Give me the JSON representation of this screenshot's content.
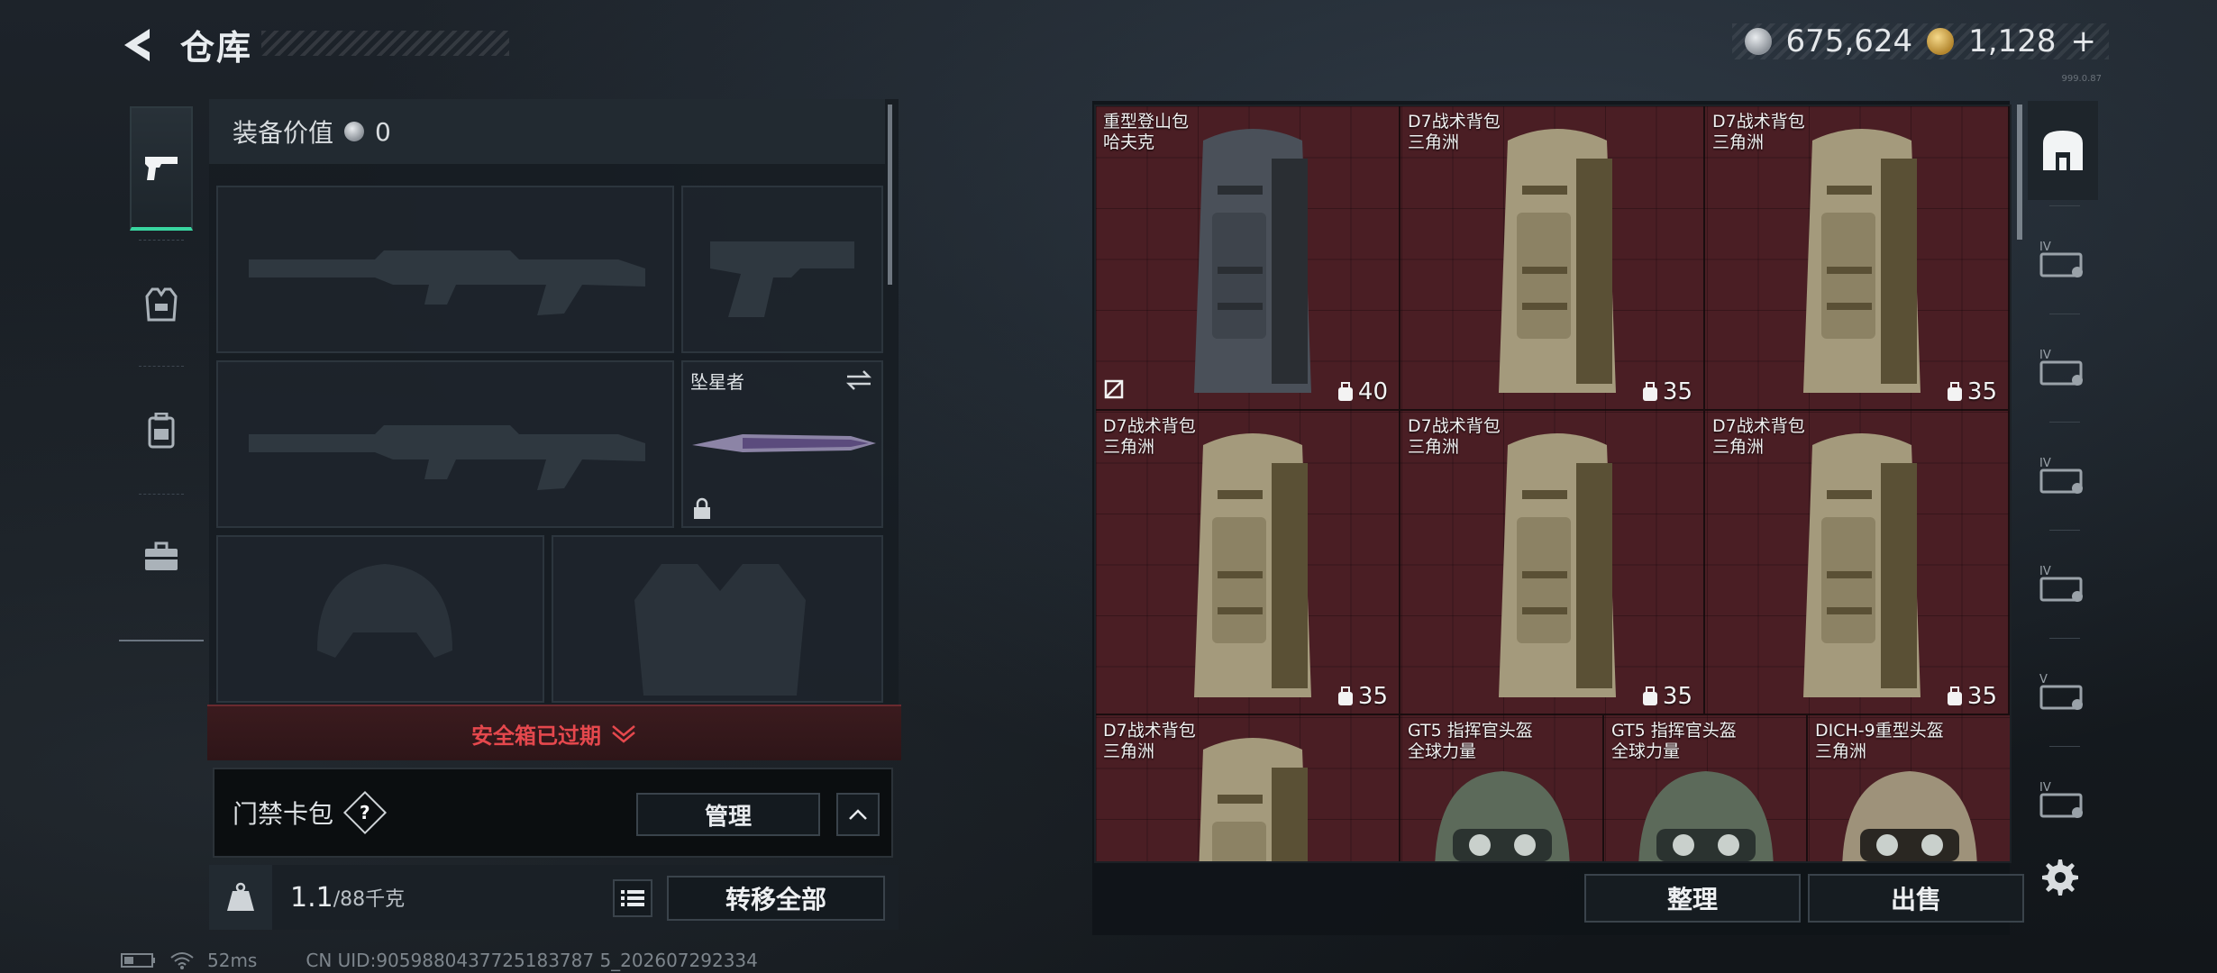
{
  "header": {
    "title": "仓库",
    "currency": [
      {
        "name": "silver-coin",
        "value": "675,624",
        "color": "#c9ced3"
      },
      {
        "name": "gold-coin",
        "value": "1,128",
        "suffix": "+",
        "color": "#d9b25a"
      }
    ],
    "version": "999.0.87"
  },
  "rail": {
    "items": [
      {
        "icon": "pistol-icon",
        "active": true
      },
      {
        "icon": "vest-icon",
        "active": false
      },
      {
        "icon": "backpack-icon",
        "active": false
      },
      {
        "icon": "toolbox-icon",
        "active": false
      }
    ]
  },
  "equipment": {
    "value_label": "装备价值",
    "value": "0",
    "melee_name": "坠星者",
    "safe_box_status": "安全箱已过期",
    "keycard_label": "门禁卡包",
    "help": "?",
    "manage_label": "管理",
    "weight_current": "1.1",
    "weight_max": "/88千克",
    "transfer_all_label": "转移全部"
  },
  "storage": {
    "items": [
      {
        "name": "重型登山包",
        "source": "哈夫克",
        "capacity": "40",
        "type": "backpack",
        "color": "grey"
      },
      {
        "name": "D7战术背包",
        "source": "三角洲",
        "capacity": "35",
        "type": "backpack",
        "color": "tan"
      },
      {
        "name": "D7战术背包",
        "source": "三角洲",
        "capacity": "35",
        "type": "backpack",
        "color": "tan"
      },
      {
        "name": "D7战术背包",
        "source": "三角洲",
        "capacity": "35",
        "type": "backpack",
        "color": "tan"
      },
      {
        "name": "D7战术背包",
        "source": "三角洲",
        "capacity": "35",
        "type": "backpack",
        "color": "tan"
      },
      {
        "name": "D7战术背包",
        "source": "三角洲",
        "capacity": "35",
        "type": "backpack",
        "color": "tan"
      },
      {
        "name": "D7战术背包",
        "source": "三角洲",
        "capacity": "",
        "type": "backpack",
        "color": "tan"
      },
      {
        "name": "GT5 指挥官头盔",
        "source": "全球力量",
        "capacity": "",
        "type": "helmet",
        "color": "green"
      },
      {
        "name": "GT5 指挥官头盔",
        "source": "全球力量",
        "capacity": "",
        "type": "helmet",
        "color": "green"
      },
      {
        "name": "DICH-9重型头盔",
        "source": "三角洲",
        "capacity": "",
        "type": "helmet",
        "color": "camo"
      }
    ],
    "sort_label": "整理",
    "sell_label": "出售"
  },
  "filters": [
    {
      "icon": "all-items-icon",
      "active": true
    },
    {
      "icon": "level-iv-folder-icon"
    },
    {
      "icon": "level-iv-card-icon"
    },
    {
      "icon": "level-iv-card-b-icon"
    },
    {
      "icon": "level-iv-card-c-icon"
    },
    {
      "icon": "level-v-card-icon"
    },
    {
      "icon": "level-iv-card-d-icon"
    }
  ],
  "status": {
    "ping": "52ms",
    "uid": "CN UID:9059880437725183787 5_202607292334"
  },
  "colors": {
    "accent_green": "#39d6a0",
    "alert_red": "#e5484d",
    "grid_red": "#4a1e24"
  }
}
